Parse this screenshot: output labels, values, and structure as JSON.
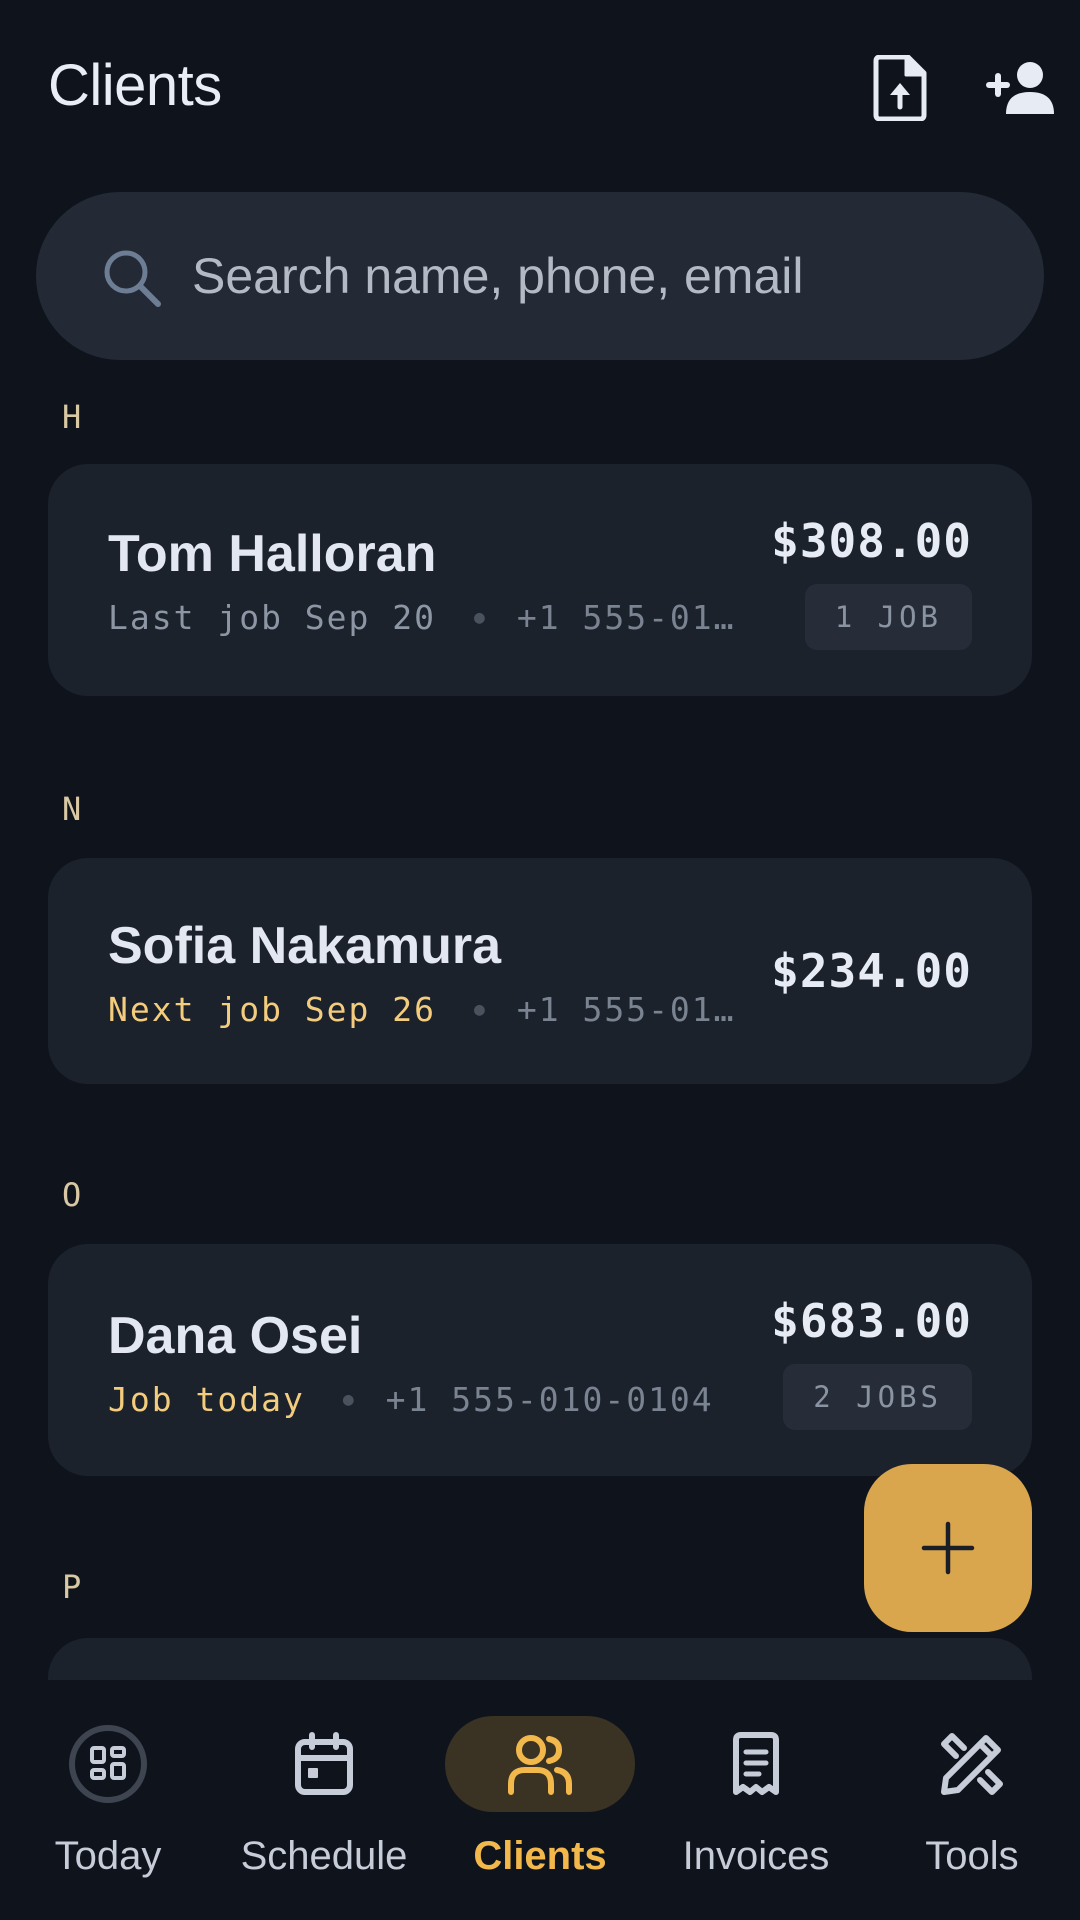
{
  "header": {
    "title": "Clients",
    "export_icon": "file-upload-icon",
    "add_icon": "add-person-icon"
  },
  "search": {
    "placeholder": "Search name, phone, email",
    "value": ""
  },
  "sections": [
    {
      "letter": "H",
      "clients": [
        {
          "name": "Tom Halloran",
          "status": "Last job Sep 20",
          "status_tone": "muted",
          "phone": "+1 555-01…",
          "amount": "$308.00",
          "badge": "1 JOB"
        }
      ]
    },
    {
      "letter": "N",
      "clients": [
        {
          "name": "Sofia Nakamura",
          "status": "Next job Sep 26",
          "status_tone": "highlight",
          "phone": "+1 555-01…",
          "amount": "$234.00",
          "badge": ""
        }
      ]
    },
    {
      "letter": "O",
      "clients": [
        {
          "name": "Dana Osei",
          "status": "Job today",
          "status_tone": "highlight",
          "phone": "+1 555-010-0104",
          "amount": "$683.00",
          "badge": "2 JOBS"
        }
      ]
    },
    {
      "letter": "P",
      "clients": []
    }
  ],
  "fab": {
    "icon": "plus-icon"
  },
  "nav": {
    "items": [
      {
        "label": "Today",
        "icon": "dashboard-icon",
        "active": false
      },
      {
        "label": "Schedule",
        "icon": "calendar-icon",
        "active": false
      },
      {
        "label": "Clients",
        "icon": "people-icon",
        "active": true
      },
      {
        "label": "Invoices",
        "icon": "receipt-icon",
        "active": false
      },
      {
        "label": "Tools",
        "icon": "tools-icon",
        "active": false
      }
    ]
  },
  "colors": {
    "background": "#0f141c",
    "card": "#1c222c",
    "accent": "#f2b84b",
    "fab": "#d9a64e",
    "highlight_text": "#f3cc7d"
  }
}
